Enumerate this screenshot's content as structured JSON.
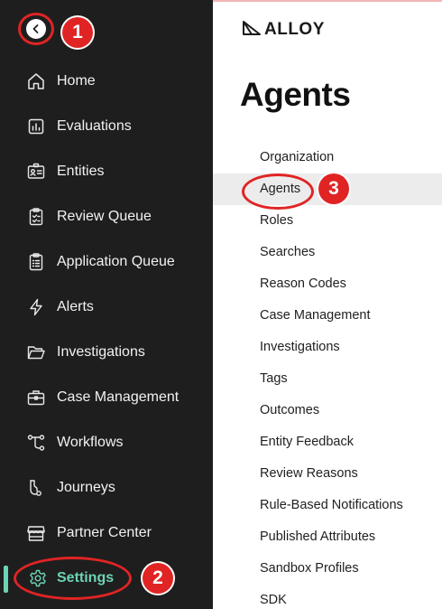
{
  "sidebar": {
    "back_icon": "chevron-left-icon",
    "items": [
      {
        "label": "Home",
        "icon": "home-icon"
      },
      {
        "label": "Evaluations",
        "icon": "chart-icon"
      },
      {
        "label": "Entities",
        "icon": "id-card-icon"
      },
      {
        "label": "Review Queue",
        "icon": "clipboard-check-icon"
      },
      {
        "label": "Application Queue",
        "icon": "clipboard-list-icon"
      },
      {
        "label": "Alerts",
        "icon": "lightning-icon"
      },
      {
        "label": "Investigations",
        "icon": "folder-open-icon"
      },
      {
        "label": "Case Management",
        "icon": "briefcase-icon"
      },
      {
        "label": "Workflows",
        "icon": "workflow-icon"
      },
      {
        "label": "Journeys",
        "icon": "journey-icon"
      },
      {
        "label": "Partner Center",
        "icon": "store-icon"
      },
      {
        "label": "Settings",
        "icon": "gear-icon",
        "active": true
      }
    ]
  },
  "annotations": {
    "step1": "1",
    "step2": "2",
    "step3": "3",
    "color": "#e02424"
  },
  "brand": {
    "logo_text": "ALLOY"
  },
  "main": {
    "title": "Agents",
    "menu": [
      "Organization",
      "Agents",
      "Roles",
      "Searches",
      "Reason Codes",
      "Case Management",
      "Investigations",
      "Tags",
      "Outcomes",
      "Entity Feedback",
      "Review Reasons",
      "Rule-Based Notifications",
      "Published Attributes",
      "Sandbox Profiles",
      "SDK"
    ],
    "selected": "Agents"
  },
  "colors": {
    "sidebar_bg": "#1e1e1e",
    "active_accent": "#6dd3b4",
    "selected_bg": "#ececec"
  }
}
